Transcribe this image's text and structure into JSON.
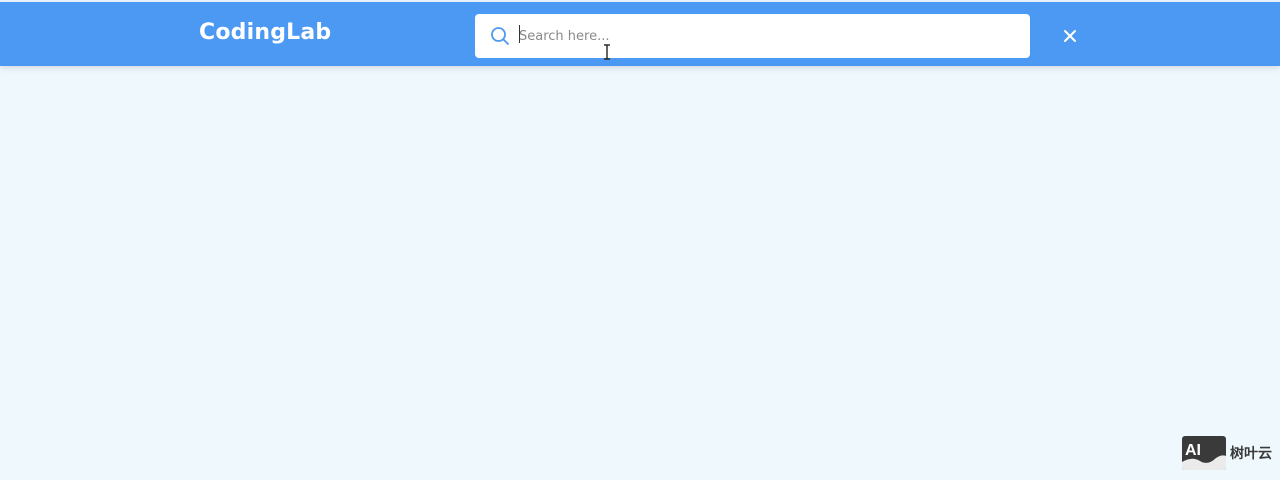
{
  "header": {
    "brand": "CodingLab",
    "search": {
      "placeholder": "Search here...",
      "value": ""
    },
    "close_icon": "close-icon",
    "search_icon": "search-icon"
  },
  "colors": {
    "header_bg": "#4b99f2",
    "page_bg": "#eef8fd",
    "search_bg": "#ffffff"
  },
  "watermark": {
    "logo_text": "AI",
    "label": "树叶云"
  }
}
